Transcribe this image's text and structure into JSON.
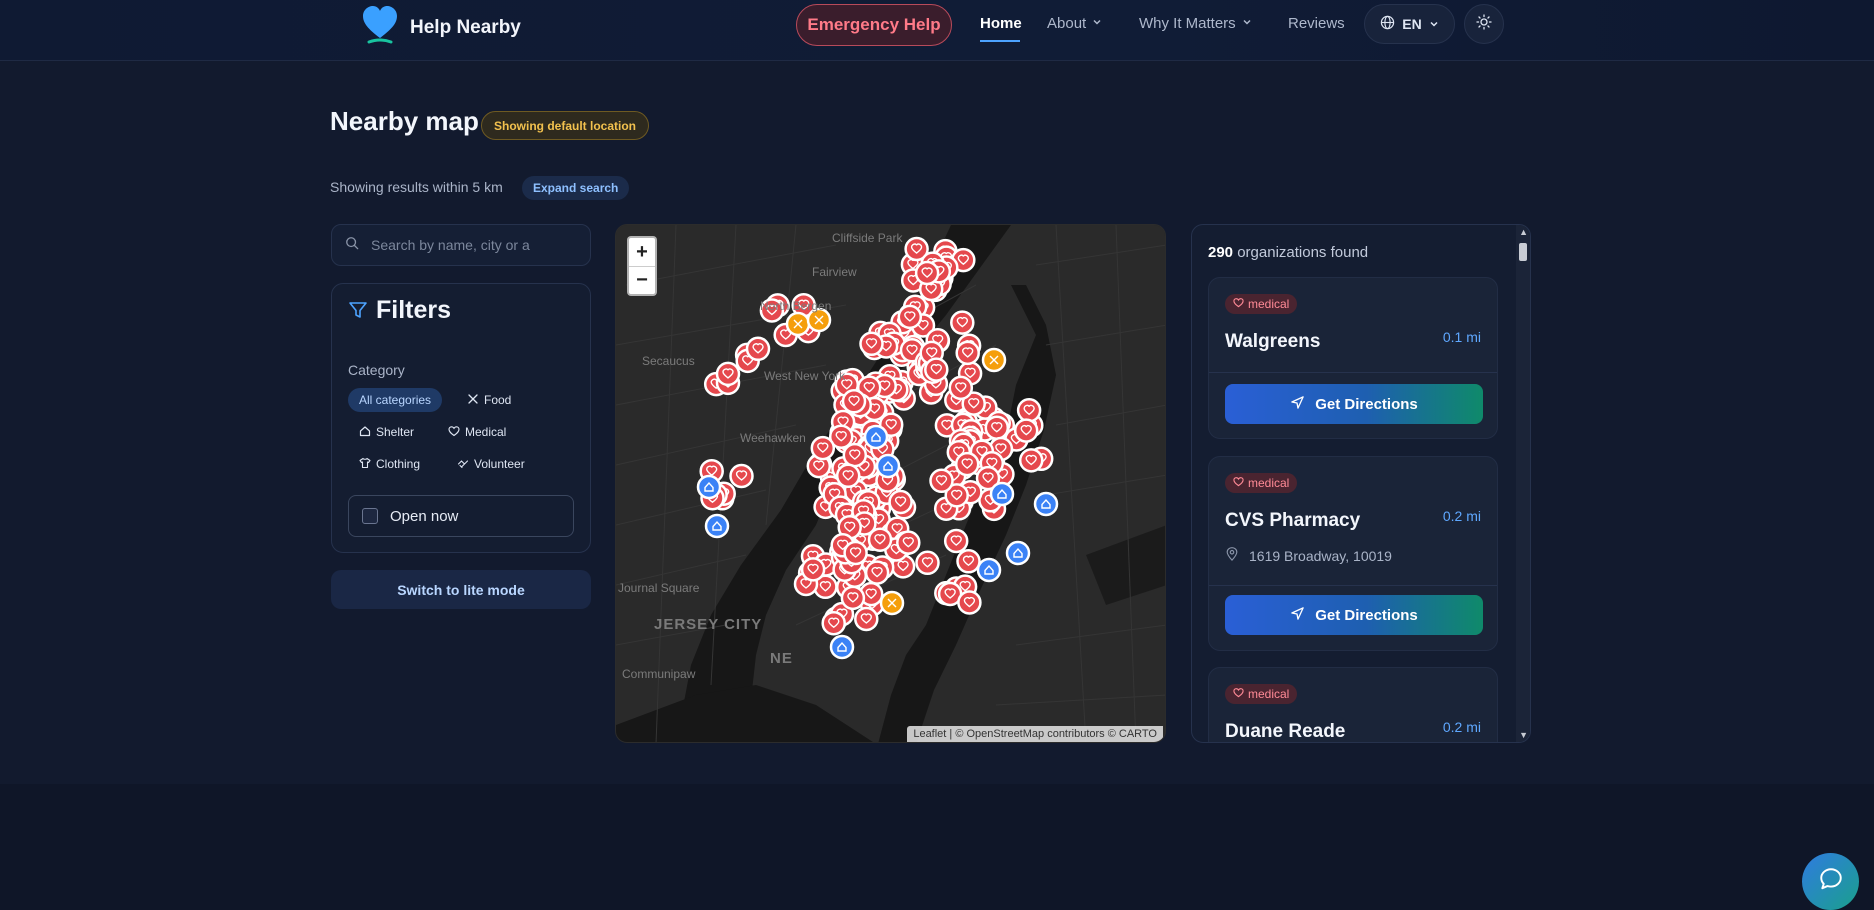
{
  "header": {
    "brand": "Help Nearby",
    "emergency": "Emergency Help",
    "nav": {
      "home": "Home",
      "about": "About",
      "why": "Why It Matters",
      "reviews": "Reviews"
    },
    "language": "EN"
  },
  "title": {
    "heading": "Nearby map",
    "badge": "Showing default location",
    "results_text": "Showing results within 5 km",
    "expand": "Expand search"
  },
  "search": {
    "placeholder": "Search by name, city or a"
  },
  "filters": {
    "title": "Filters",
    "category_label": "Category",
    "categories": [
      "All categories",
      "Food",
      "Shelter",
      "Medical",
      "Clothing",
      "Volunteer"
    ],
    "open_now": "Open now",
    "open_now_checked": false
  },
  "lite_mode": "Switch to lite mode",
  "map": {
    "zoom_in": "+",
    "zoom_out": "−",
    "attribution": "Leaflet | © OpenStreetMap contributors © CARTO",
    "places": [
      "Cliffside Park",
      "Fairview",
      "North Bergen",
      "Secaucus",
      "West New York",
      "Weehawken",
      "Journal Square",
      "JERSEY CITY",
      "NE",
      "Communipaw"
    ]
  },
  "results": {
    "count": "290",
    "count_suffix": "organizations found",
    "directions": "Get Directions",
    "items": [
      {
        "category": "medical",
        "name": "Walgreens",
        "distance": "0.1 mi"
      },
      {
        "category": "medical",
        "name": "CVS Pharmacy",
        "distance": "0.2 mi",
        "address": "1619 Broadway, 10019"
      },
      {
        "category": "medical",
        "name": "Duane Reade",
        "distance": "0.2 mi"
      }
    ]
  },
  "colors": {
    "medical_marker": "#e5484d",
    "shelter_marker": "#3b82f6",
    "food_marker": "#f59e0b",
    "accent": "#4da3ff"
  }
}
